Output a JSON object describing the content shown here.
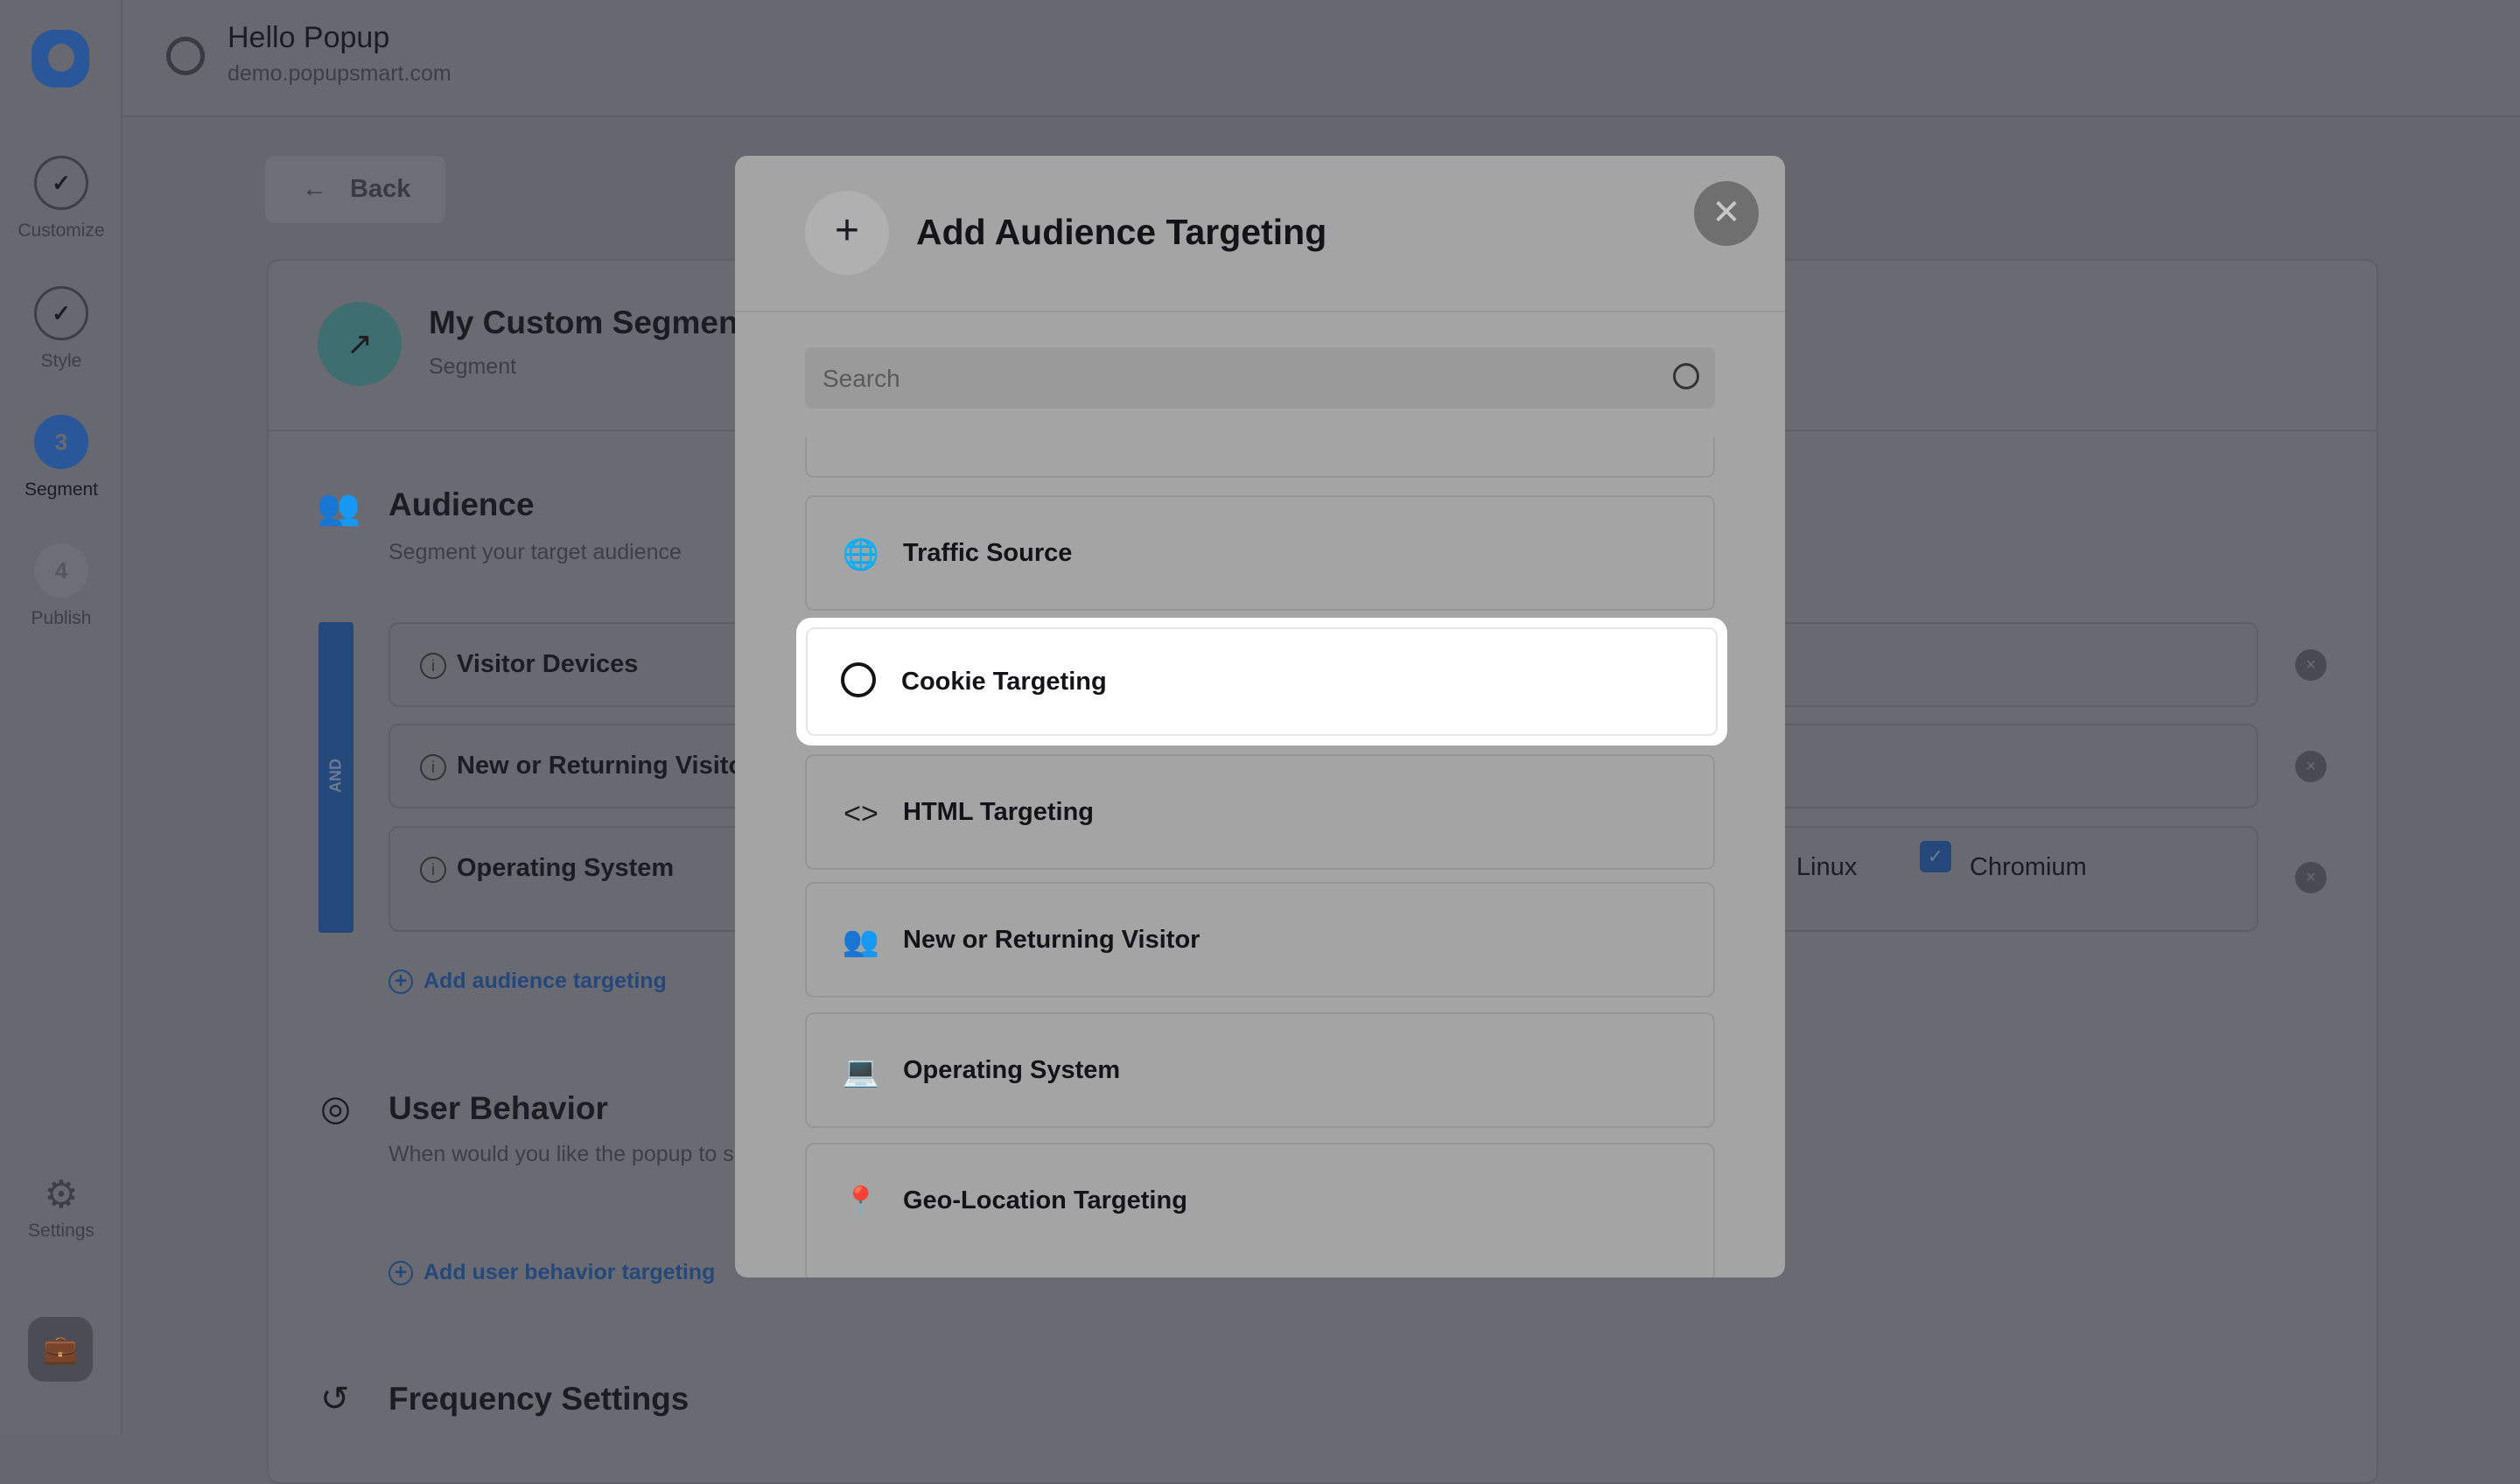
{
  "app": {
    "title": "Hello Popup",
    "domain": "demo.popupsmart.com",
    "brand_color": "#2a569a"
  },
  "steps": [
    {
      "label": "Customize",
      "state": "done"
    },
    {
      "label": "Style",
      "state": "done"
    },
    {
      "label": "Segment",
      "number": "3",
      "state": "active"
    },
    {
      "label": "Publish",
      "number": "4",
      "state": "pending"
    }
  ],
  "sidebar_bottom": {
    "settings": "Settings"
  },
  "back": "Back",
  "segment": {
    "title": "My Custom Segment",
    "subtitle": "Segment"
  },
  "audience": {
    "title": "Audience",
    "subtitle": "Segment your target audience",
    "operator": "AND",
    "rows": [
      "Visitor Devices",
      "New or Returning Visitor",
      "Operating System"
    ],
    "os_options": [
      {
        "label": "Linux",
        "checked": false
      },
      {
        "label": "Chromium",
        "checked": true
      }
    ],
    "add": "Add audience targeting"
  },
  "behavior": {
    "title": "User Behavior",
    "subtitle": "When would you like the popup to show?",
    "add": "Add user behavior targeting"
  },
  "frequency": {
    "title": "Frequency Settings"
  },
  "modal": {
    "title": "Add Audience Targeting",
    "search_placeholder": "Search",
    "items": [
      {
        "label": "Traffic Source",
        "icon": "globe-search"
      },
      {
        "label": "Cookie Targeting",
        "icon": "cookie",
        "highlighted": true
      },
      {
        "label": "HTML Targeting",
        "icon": "code"
      },
      {
        "label": "New or Returning Visitor",
        "icon": "users"
      },
      {
        "label": "Operating System",
        "icon": "laptop-gear"
      },
      {
        "label": "Geo-Location Targeting",
        "icon": "map-pin"
      }
    ]
  }
}
